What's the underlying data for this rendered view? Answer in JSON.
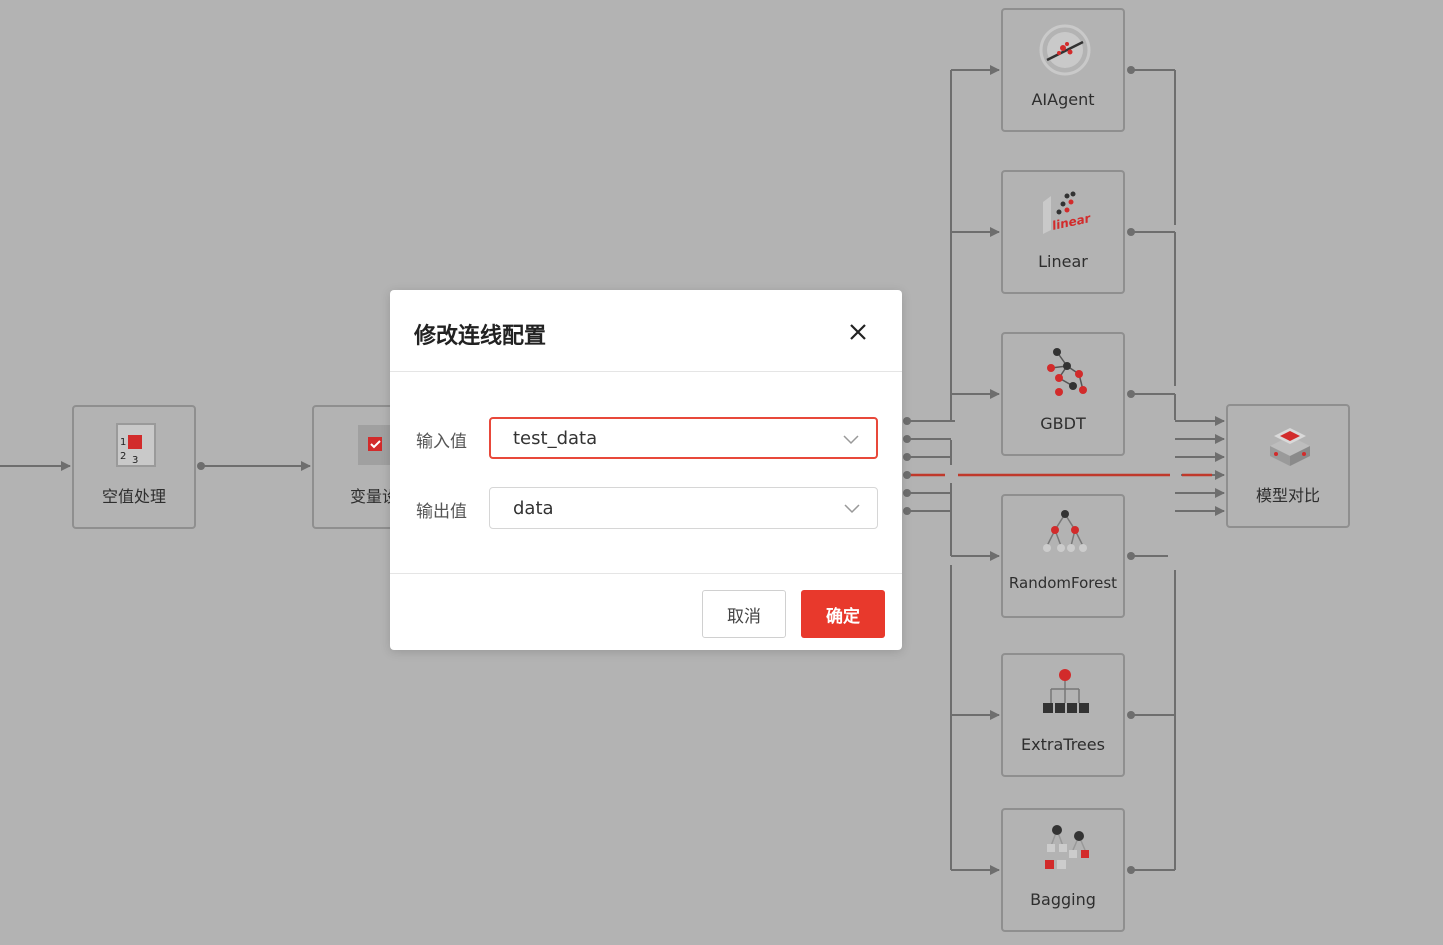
{
  "canvas": {
    "nodes": [
      {
        "id": "kongzhi",
        "label": "空值处理",
        "icon": "numbered-grid-icon"
      },
      {
        "id": "bianliang",
        "label": "变量设",
        "icon": "cube-check-icon"
      },
      {
        "id": "aiagent",
        "label": "AIAgent",
        "icon": "compass-icon"
      },
      {
        "id": "linear",
        "label": "Linear",
        "icon": "linear-icon"
      },
      {
        "id": "gbdt",
        "label": "GBDT",
        "icon": "tree-graph-icon"
      },
      {
        "id": "randomforest",
        "label": "RandomForest",
        "icon": "random-forest-icon"
      },
      {
        "id": "extratrees",
        "label": "ExtraTrees",
        "icon": "hierarchy-icon"
      },
      {
        "id": "bagging",
        "label": "Bagging",
        "icon": "bagging-icon"
      },
      {
        "id": "compare",
        "label": "模型对比",
        "icon": "stack-compare-icon"
      }
    ],
    "colors": {
      "edge": "#6e6e6e",
      "highlight_edge": "#c0392b"
    }
  },
  "dialog": {
    "title": "修改连线配置",
    "input_label": "输入值",
    "input_value": "test_data",
    "output_label": "输出值",
    "output_value": "data",
    "cancel_label": "取消",
    "confirm_label": "确定",
    "accent": "#e8392c"
  }
}
